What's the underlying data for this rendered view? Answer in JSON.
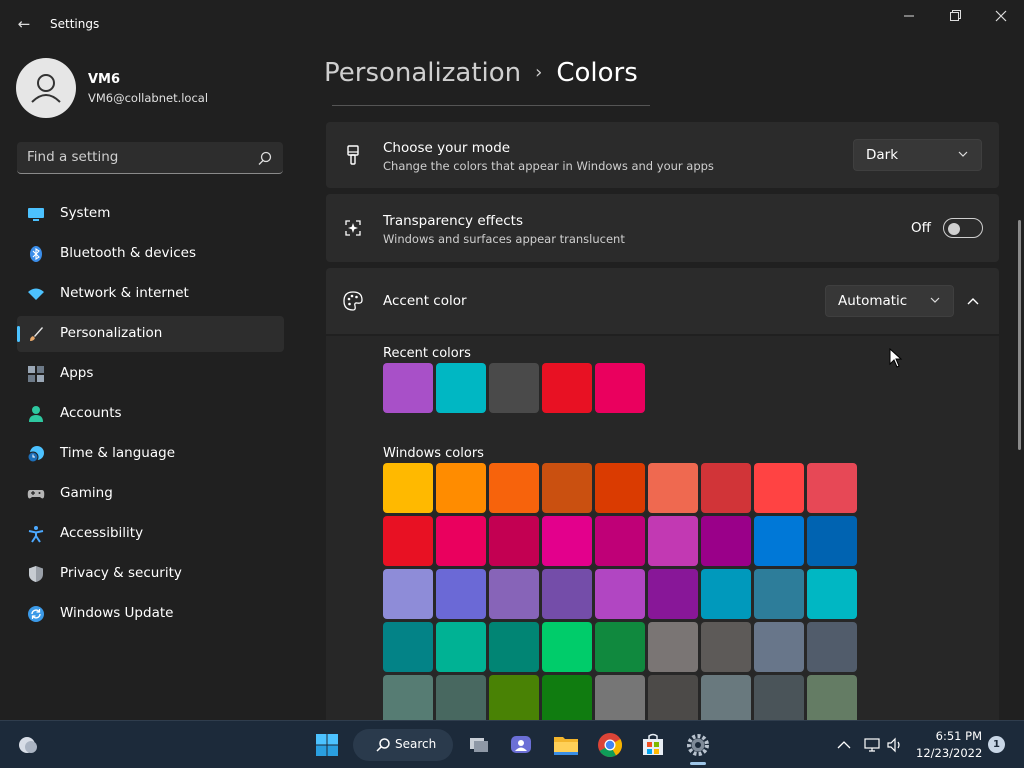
{
  "window": {
    "title": "Settings",
    "icons": {
      "back": "back-arrow-icon",
      "minimize": "minimize-icon",
      "maximize": "restore-icon",
      "close": "close-icon"
    }
  },
  "user": {
    "name": "VM6",
    "email": "VM6@collabnet.local",
    "avatar_icon": "person-icon"
  },
  "search": {
    "placeholder": "Find a setting",
    "icon": "search-icon"
  },
  "sidebar": {
    "items": [
      {
        "label": "System",
        "icon": "system-icon",
        "color": "#4cc2ff"
      },
      {
        "label": "Bluetooth & devices",
        "icon": "bluetooth-icon",
        "color": "#3b8eea"
      },
      {
        "label": "Network & internet",
        "icon": "wifi-icon",
        "color": "#4cc2ff"
      },
      {
        "label": "Personalization",
        "icon": "brush-icon",
        "color": "#e8a86a",
        "active": true
      },
      {
        "label": "Apps",
        "icon": "apps-icon",
        "color": "#9aa7b5"
      },
      {
        "label": "Accounts",
        "icon": "accounts-icon",
        "color": "#2ec8a0"
      },
      {
        "label": "Time & language",
        "icon": "clock-globe-icon",
        "color": "#4cc2ff"
      },
      {
        "label": "Gaming",
        "icon": "gamepad-icon",
        "color": "#b5b5b5"
      },
      {
        "label": "Accessibility",
        "icon": "accessibility-icon",
        "color": "#4ca9ff"
      },
      {
        "label": "Privacy & security",
        "icon": "shield-icon",
        "color": "#9aa0a8"
      },
      {
        "label": "Windows Update",
        "icon": "update-icon",
        "color": "#3b9ae8"
      }
    ]
  },
  "breadcrumb": {
    "parent": "Personalization",
    "separator": "›",
    "current": "Colors"
  },
  "mode": {
    "title": "Choose your mode",
    "subtitle": "Change the colors that appear in Windows and your apps",
    "value": "Dark",
    "icon": "paintbrush-icon"
  },
  "transparency": {
    "title": "Transparency effects",
    "subtitle": "Windows and surfaces appear translucent",
    "state_label": "Off",
    "enabled": false,
    "icon": "sparkle-icon"
  },
  "accent": {
    "title": "Accent color",
    "value": "Automatic",
    "icon": "palette-icon",
    "expanded": true
  },
  "recent_colors": {
    "label": "Recent colors",
    "colors": [
      "#a850c8",
      "#00b7c3",
      "#4a4a4a",
      "#e81123",
      "#ea005e"
    ]
  },
  "windows_colors": {
    "label": "Windows colors",
    "rows": [
      [
        "#ffb900",
        "#ff8c00",
        "#f7630c",
        "#ca5010",
        "#da3b01",
        "#ef6950",
        "#d13438",
        "#ff4343",
        "#e74856"
      ],
      [
        "#e81123",
        "#ea005e",
        "#c30052",
        "#e3008c",
        "#bf0077",
        "#c239b3",
        "#9a0089",
        "#0078d7",
        "#0063b1"
      ],
      [
        "#8e8cd8",
        "#6b69d6",
        "#8764b8",
        "#744da9",
        "#b146c2",
        "#881798",
        "#0099bc",
        "#2d7d9a",
        "#00b7c3"
      ],
      [
        "#038387",
        "#00b294",
        "#018574",
        "#00cc6a",
        "#10893e",
        "#7a7574",
        "#5d5a58",
        "#68768a",
        "#515c6b"
      ],
      [
        "#567c73",
        "#486860",
        "#498205",
        "#107c10",
        "#767676",
        "#4c4a48",
        "#69797e",
        "#4a5459",
        "#647c64"
      ]
    ]
  },
  "taskbar": {
    "search_label": "Search",
    "time": "6:51 PM",
    "date": "12/23/2022",
    "notification_count": "1",
    "apps": [
      "widgets-icon",
      "start-icon",
      "search-icon",
      "task-view-icon",
      "chat-icon",
      "file-explorer-icon",
      "chrome-icon",
      "store-icon",
      "settings-icon"
    ],
    "tray": [
      "chevron-up-icon",
      "network-icon",
      "volume-icon"
    ]
  }
}
